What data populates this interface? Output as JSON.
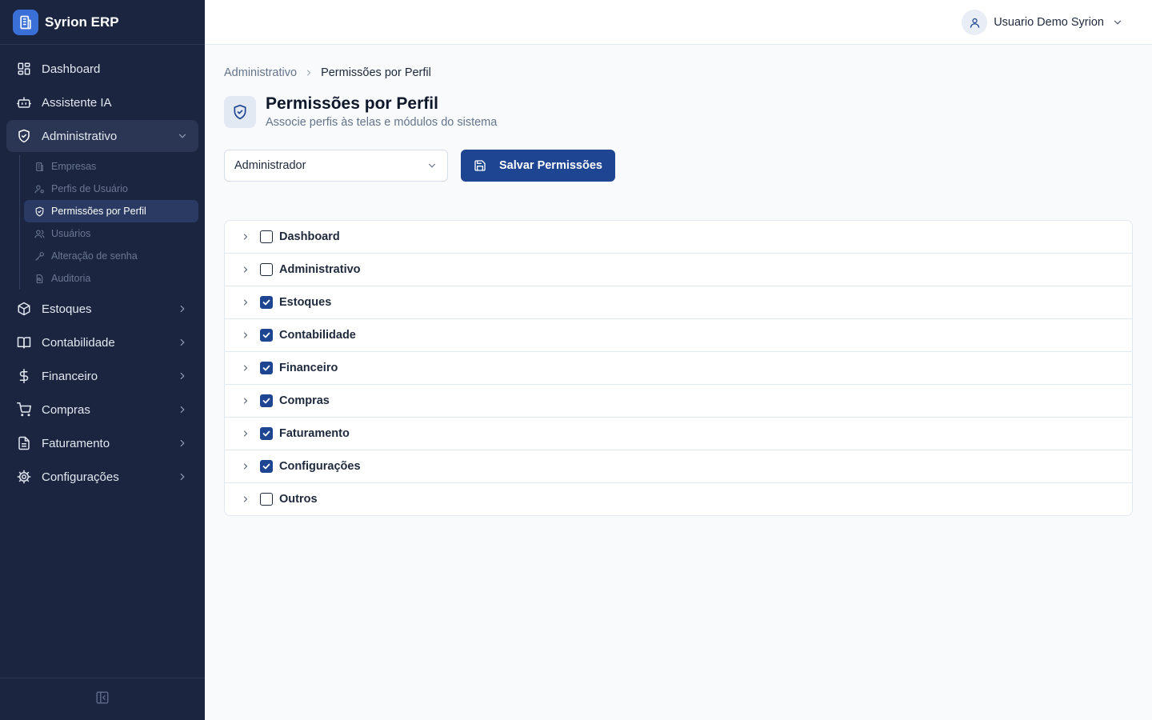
{
  "app": {
    "name": "Syrion ERP"
  },
  "sidebar": {
    "items": [
      {
        "label": "Dashboard"
      },
      {
        "label": "Assistente IA"
      },
      {
        "label": "Administrativo"
      },
      {
        "label": "Estoques"
      },
      {
        "label": "Contabilidade"
      },
      {
        "label": "Financeiro"
      },
      {
        "label": "Compras"
      },
      {
        "label": "Faturamento"
      },
      {
        "label": "Configurações"
      }
    ],
    "subitems": [
      {
        "label": "Empresas"
      },
      {
        "label": "Perfis de Usuário"
      },
      {
        "label": "Permissões por Perfil"
      },
      {
        "label": "Usuários"
      },
      {
        "label": "Alteração de senha"
      },
      {
        "label": "Auditoria"
      }
    ]
  },
  "topbar": {
    "user_name": "Usuario Demo Syrion"
  },
  "breadcrumb": {
    "parent": "Administrativo",
    "current": "Permissões por Perfil"
  },
  "page": {
    "title": "Permissões por Perfil",
    "subtitle": "Associe perfis às telas e módulos do sistema"
  },
  "controls": {
    "profile_selected": "Administrador",
    "save_label": "Salvar Permissões"
  },
  "modules": [
    {
      "label": "Dashboard",
      "checked": false
    },
    {
      "label": "Administrativo",
      "checked": false
    },
    {
      "label": "Estoques",
      "checked": true
    },
    {
      "label": "Contabilidade",
      "checked": true
    },
    {
      "label": "Financeiro",
      "checked": true
    },
    {
      "label": "Compras",
      "checked": true
    },
    {
      "label": "Faturamento",
      "checked": true
    },
    {
      "label": "Configurações",
      "checked": true
    },
    {
      "label": "Outros",
      "checked": false
    }
  ],
  "colors": {
    "sidebar_bg": "#1b2540",
    "primary": "#1e4592",
    "brand_logo": "#3b6fd8"
  }
}
